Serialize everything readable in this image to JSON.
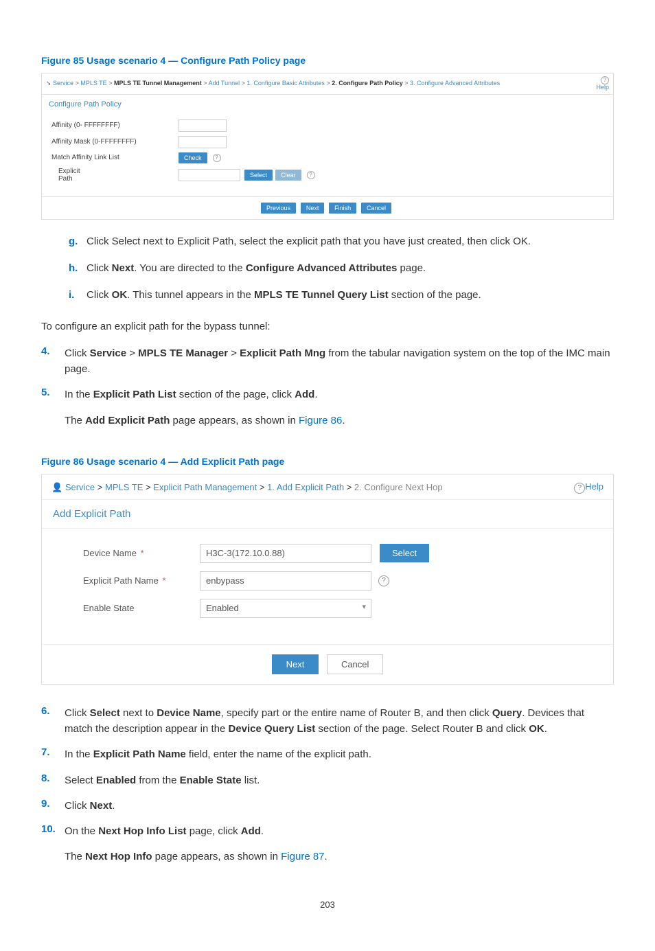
{
  "figure85": {
    "caption": "Figure 85 Usage scenario 4 — Configure Path Policy page",
    "breadcrumb": {
      "parts": [
        "Service",
        "MPLS TE",
        "MPLS TE Tunnel Management",
        "Add Tunnel",
        "1. Configure Basic Attributes",
        "2. Configure Path Policy",
        "3. Configure Advanced Attributes"
      ],
      "bold_index": 5
    },
    "help_label": "Help",
    "section_title": "Configure Path Policy",
    "labels": {
      "affinity": "Affinity (0- FFFFFFFF)",
      "affinity_mask": "Affinity Mask (0-FFFFFFFF)",
      "match_link": "Match Affinity Link List",
      "explicit_path": "Explicit\nPath"
    },
    "buttons": {
      "check": "Check",
      "select": "Select",
      "clear": "Clear",
      "previous": "Previous",
      "next": "Next",
      "finish": "Finish",
      "cancel": "Cancel"
    }
  },
  "sub_list": {
    "g": "Click Select next to Explicit Path, select the explicit path that you have just created, then click OK.",
    "h_pre": "Click ",
    "h_b1": "Next",
    "h_mid": ". You are directed to the ",
    "h_b2": "Configure Advanced Attributes",
    "h_post": " page.",
    "i_pre": "Click ",
    "i_b1": "OK",
    "i_mid": ". This tunnel appears in the ",
    "i_b2": "MPLS TE Tunnel Query List",
    "i_post": " section of the page."
  },
  "para_intro": "To configure an explicit path for the bypass tunnel:",
  "steps": {
    "s4_pre": "Click ",
    "s4_b1": "Service",
    "s4_sep": " > ",
    "s4_b2": "MPLS TE Manager",
    "s4_b3": "Explicit Path Mng",
    "s4_post": " from the tabular navigation system on the top of the IMC main page.",
    "s5_pre": "In the ",
    "s5_b1": "Explicit Path List",
    "s5_mid": " section of the page, click ",
    "s5_b2": "Add",
    "s5_post": ".",
    "s5_sub_pre": "The ",
    "s5_sub_b": "Add Explicit Path",
    "s5_sub_mid": " page appears, as shown in ",
    "s5_sub_link": "Figure 86",
    "s5_sub_post": ".",
    "s6_pre": "Click ",
    "s6_b1": "Select",
    "s6_m1": " next to ",
    "s6_b2": "Device Name",
    "s6_m2": ", specify part or the entire name of Router B, and then click ",
    "s6_b3": "Query",
    "s6_m3": ". Devices that match the description appear in the ",
    "s6_b4": "Device Query List",
    "s6_m4": " section of the page. Select Router B and click ",
    "s6_b5": "OK",
    "s6_post": ".",
    "s7_pre": "In the ",
    "s7_b1": "Explicit Path Name",
    "s7_post": " field, enter the name of the explicit path.",
    "s8_pre": "Select ",
    "s8_b1": "Enabled",
    "s8_mid": " from the ",
    "s8_b2": "Enable State",
    "s8_post": " list.",
    "s9_pre": "Click ",
    "s9_b1": "Next",
    "s9_post": ".",
    "s10_pre": "On the ",
    "s10_b1": "Next Hop Info List",
    "s10_mid": " page, click ",
    "s10_b2": "Add",
    "s10_post": ".",
    "s10_sub_pre": "The ",
    "s10_sub_b": "Next Hop Info",
    "s10_sub_mid": " page appears, as shown in ",
    "s10_sub_link": "Figure 87",
    "s10_sub_post": "."
  },
  "figure86": {
    "caption": "Figure 86 Usage scenario 4 — Add Explicit Path page",
    "breadcrumb": {
      "parts": [
        "Service",
        "MPLS TE",
        "Explicit Path Management",
        "1. Add Explicit Path",
        "2. Configure Next Hop"
      ]
    },
    "help_label": "Help",
    "section_title": "Add Explicit Path",
    "labels": {
      "device_name": "Device Name",
      "explicit_path_name": "Explicit Path Name",
      "enable_state": "Enable State"
    },
    "values": {
      "device_name": "H3C-3(172.10.0.88)",
      "explicit_path_name": "enbypass",
      "enable_state": "Enabled"
    },
    "buttons": {
      "select": "Select",
      "next": "Next",
      "cancel": "Cancel"
    }
  },
  "page_number": "203"
}
